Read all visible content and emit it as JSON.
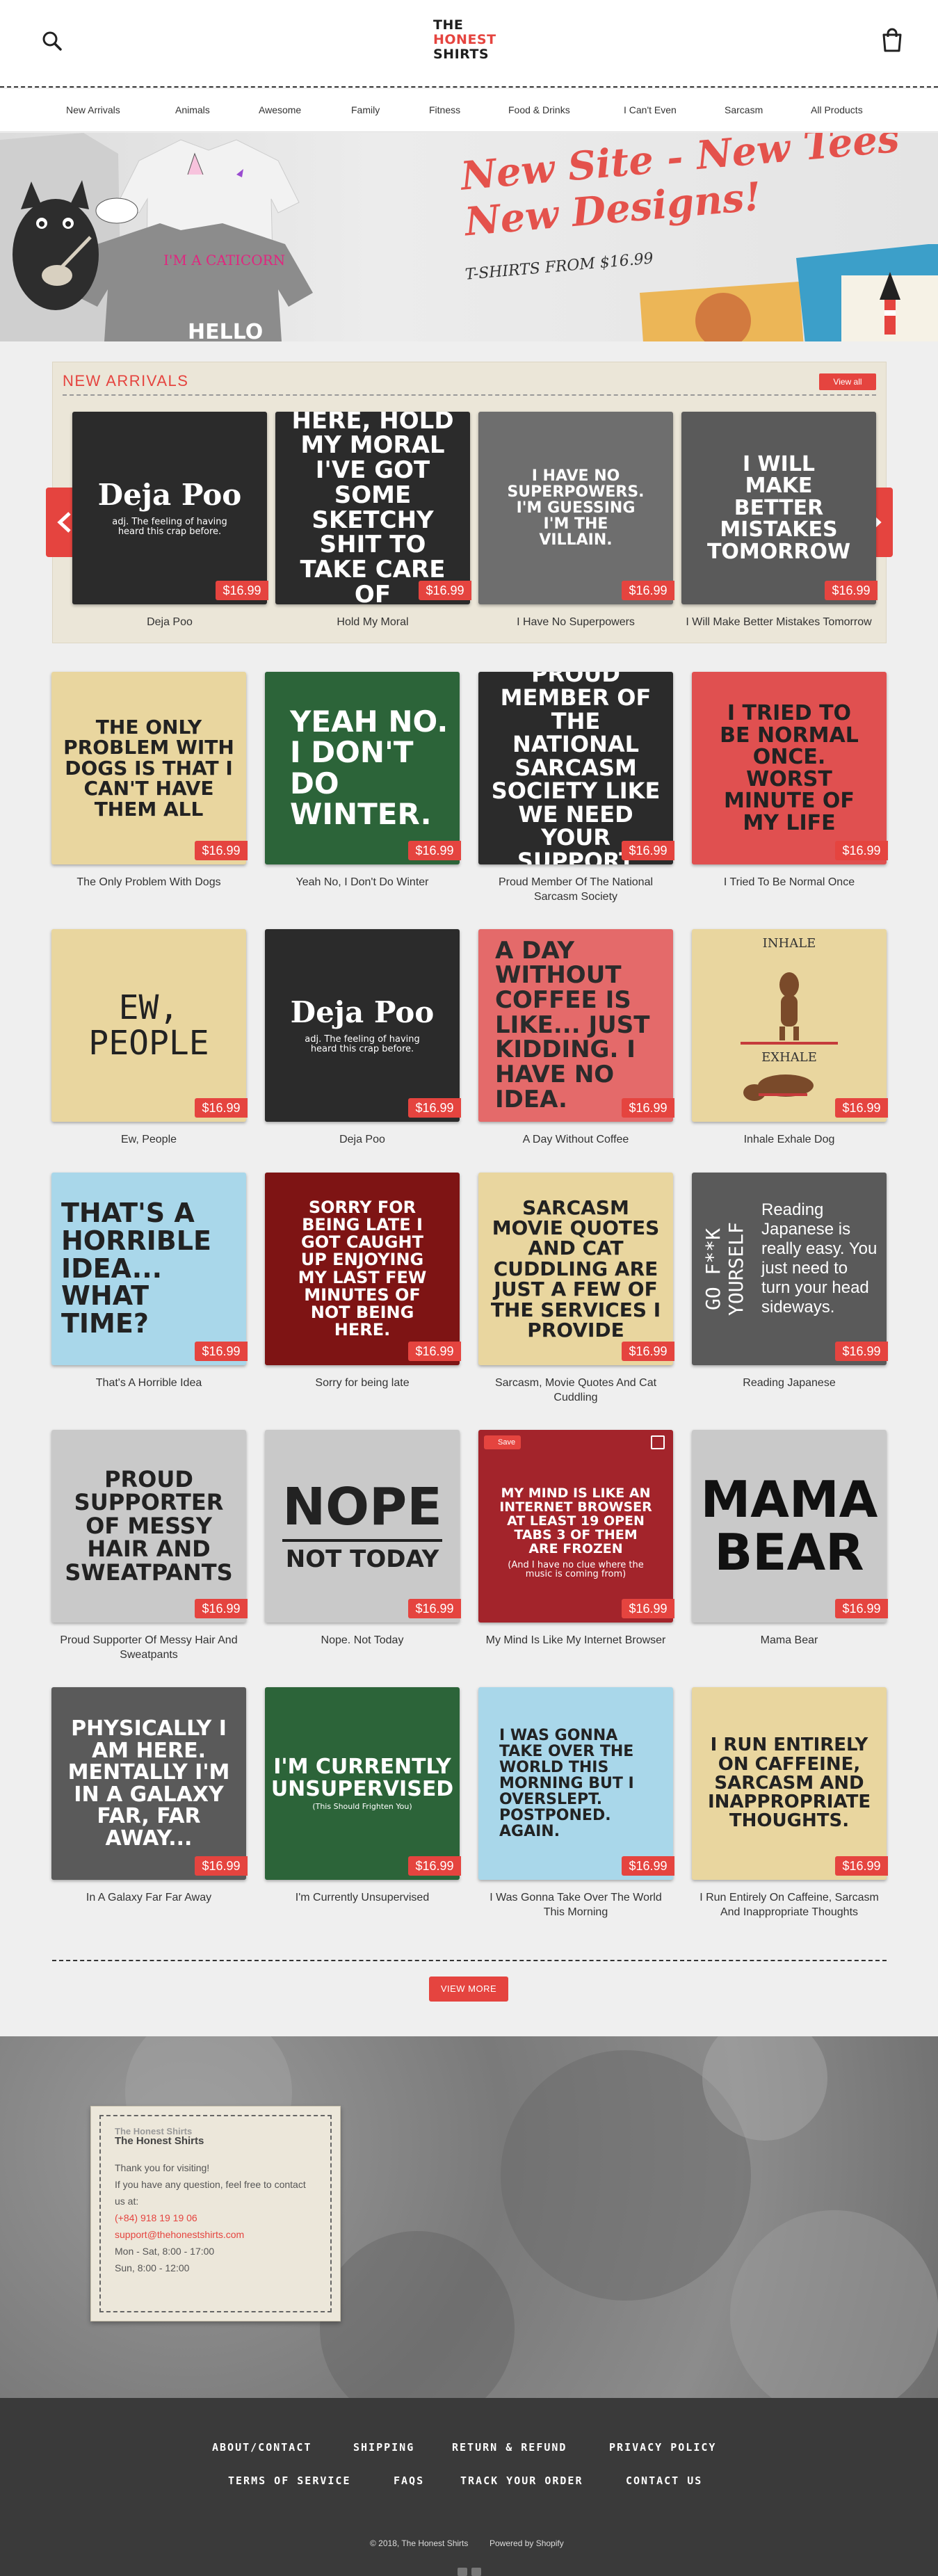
{
  "header": {
    "logo_line1": "THE",
    "logo_line2": "HONEST",
    "logo_line3": "SHIRTS"
  },
  "nav": [
    "New Arrivals",
    "Animals",
    "Awesome",
    "Family",
    "Fitness",
    "Food & Drinks",
    "I Can't Even",
    "Sarcasm",
    "All Products"
  ],
  "hero": {
    "title_line1": "New Site - New Tees",
    "title_line2": "New Designs!",
    "subtitle": "T-SHIRTS FROM $16.99",
    "shirt1_text": "I'M A CATICORN",
    "shirt2_text": "HELLO"
  },
  "new_arrivals": {
    "title": "NEW ARRIVALS",
    "view_all": "View all",
    "items": [
      {
        "name": "Deja Poo",
        "price": "$16.99",
        "art_title": "Deja Poo",
        "art_sub": "adj. The feeling of having heard this crap before."
      },
      {
        "name": "Hold My Moral",
        "price": "$16.99",
        "art": "HERE, HOLD MY MORAL I'VE GOT SOME SKETCHY SHIT TO TAKE CARE OF"
      },
      {
        "name": "I Have No Superpowers",
        "price": "$16.99",
        "art": "I HAVE NO SUPERPOWERS. I'M GUESSING I'M THE VILLAIN."
      },
      {
        "name": "I Will Make Better Mistakes Tomorrow",
        "price": "$16.99",
        "art": "I WILL MAKE BETTER MISTAKES TOMORROW"
      }
    ]
  },
  "products": [
    {
      "name": "The Only Problem With Dogs",
      "price": "$16.99",
      "art": "THE ONLY PROBLEM WITH DOGS IS THAT I CAN'T HAVE THEM ALL"
    },
    {
      "name": "Yeah No, I Don't Do Winter",
      "price": "$16.99",
      "art": "YEAH NO. I DON'T DO WINTER."
    },
    {
      "name": "Proud Member Of The National Sarcasm Society",
      "price": "$16.99",
      "art": "PROUD MEMBER OF THE NATIONAL SARCASM SOCIETY LIKE WE NEED YOUR SUPPORT"
    },
    {
      "name": "I Tried To Be Normal Once",
      "price": "$16.99",
      "art": "I TRIED TO BE NORMAL ONCE. WORST MINUTE OF MY LIFE"
    },
    {
      "name": "Ew, People",
      "price": "$16.99",
      "art": "EW, PEOPLE"
    },
    {
      "name": "Deja Poo",
      "price": "$16.99",
      "art_title": "Deja Poo",
      "art_sub": "adj. The feeling of having heard this crap before."
    },
    {
      "name": "A Day Without Coffee",
      "price": "$16.99",
      "art": "A DAY WITHOUT COFFEE IS LIKE... JUST KIDDING. I HAVE NO IDEA."
    },
    {
      "name": "Inhale Exhale Dog",
      "price": "$16.99",
      "art_top": "INHALE",
      "art_bottom": "EXHALE"
    },
    {
      "name": "That's A Horrible Idea",
      "price": "$16.99",
      "art": "THAT'S A HORRIBLE IDEA... WHAT TIME?"
    },
    {
      "name": "Sorry for being late",
      "price": "$16.99",
      "art": "SORRY FOR BEING LATE I GOT CAUGHT UP ENJOYING MY LAST FEW MINUTES OF NOT BEING HERE."
    },
    {
      "name": "Sarcasm, Movie Quotes And Cat Cuddling",
      "price": "$16.99",
      "art": "SARCASM MOVIE QUOTES AND CAT CUDDLING ARE JUST A FEW OF THE SERVICES I PROVIDE"
    },
    {
      "name": "Reading Japanese",
      "price": "$16.99",
      "art_side": "GO F**K YOURSELF",
      "art": "Reading Japanese is really easy. You just need to turn your head sideways."
    },
    {
      "name": "Proud Supporter Of Messy Hair And Sweatpants",
      "price": "$16.99",
      "art": "PROUD SUPPORTER of MESSY HAIR and SWEATPANTS"
    },
    {
      "name": "Nope. Not Today",
      "price": "$16.99",
      "art_title": "NOPE",
      "art_sub": "NOT TODAY"
    },
    {
      "name": "My Mind Is Like My Internet Browser",
      "price": "$16.99",
      "save": "Save",
      "art": "MY MIND IS LIKE AN INTERNET BROWSER AT LEAST 19 OPEN TABS 3 OF THEM ARE FROZEN",
      "art_sub": "(And I have no clue where the music is coming from)"
    },
    {
      "name": "Mama Bear",
      "price": "$16.99",
      "art": "MAMA BEAR"
    },
    {
      "name": "In A Galaxy Far Far Away",
      "price": "$16.99",
      "art": "PHYSICALLY I AM HERE. MENTALLY I'M IN A GALAXY FAR, FAR AWAY..."
    },
    {
      "name": "I'm Currently Unsupervised",
      "price": "$16.99",
      "art": "I'M CURRENTLY UNSUPERVISED",
      "art_sub": "(This Should Frighten You)"
    },
    {
      "name": "I Was Gonna Take Over The World This Morning",
      "price": "$16.99",
      "art": "I WAS GONNA TAKE OVER THE WORLD THIS MORNING BUT I OVERSLEPT. POSTPONED. AGAIN."
    },
    {
      "name": "I Run Entirely On Caffeine, Sarcasm And Inappropriate Thoughts",
      "price": "$16.99",
      "art": "I RUN ENTIRELY ON CAFFEINE, SARCASM AND INAPPROPRIATE THOUGHTS."
    }
  ],
  "view_more": "VIEW MORE",
  "contact": {
    "ghost": "The Honest Shirts",
    "title": "The Honest Shirts",
    "line1": "Thank you for visiting!",
    "line2": "If you have any question, feel free to contact us at:",
    "phone": "(+84) 918 19 19 06",
    "email": "support@thehonestshirts.com",
    "hours1": "Mon - Sat, 8:00 - 17:00",
    "hours2": "Sun, 8:00 - 12:00"
  },
  "footer": {
    "links": [
      "ABOUT/CONTACT",
      "SHIPPING",
      "RETURN & REFUND",
      "PRIVACY POLICY",
      "TERMS OF SERVICE",
      "FAQS",
      "TRACK YOUR ORDER",
      "CONTACT US"
    ],
    "copyright": "© 2018, The Honest Shirts",
    "powered": "Powered by Shopify"
  },
  "colors": {
    "accent": "#e5443f",
    "footer": "#3a3a3a",
    "panel": "#ebe6d8"
  }
}
